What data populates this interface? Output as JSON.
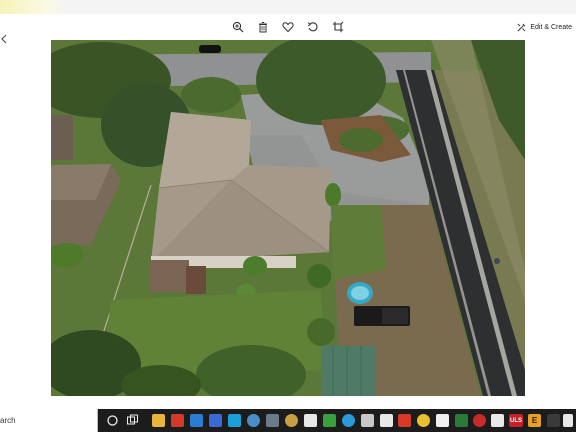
{
  "toolbar": {
    "zoom_icon": "zoom-in-icon",
    "delete_icon": "trash-icon",
    "favorite_icon": "heart-icon",
    "rotate_icon": "rotate-icon",
    "crop_icon": "crop-icon",
    "edit_create_label": "Edit & Create"
  },
  "taskbar": {
    "search_text": "arch",
    "apps": [
      "task-view-icon",
      "file-explorer-icon",
      "app-icon-2",
      "mail-icon",
      "app-icon-4",
      "steam-icon",
      "app-icon-6",
      "app-icon-7",
      "app-icon-8",
      "store-icon",
      "edge-icon",
      "app-icon-11",
      "iheart-icon",
      "winamp-icon",
      "chrome-icon",
      "app-icon-15",
      "app-icon-16",
      "app-icon-17",
      "app-icon-18",
      "pinterest-icon",
      "app-icon-20",
      "uls-icon",
      "app-icon-22",
      "app-icon-23"
    ],
    "uls_label": "ULS",
    "e_label": "E"
  },
  "colors": {
    "accent_yellow": "#f6f3b8",
    "taskbar": "#1c1c1c",
    "grass": "#5c7a3a",
    "roof": "#a59a8a",
    "road": "#2f3133"
  }
}
